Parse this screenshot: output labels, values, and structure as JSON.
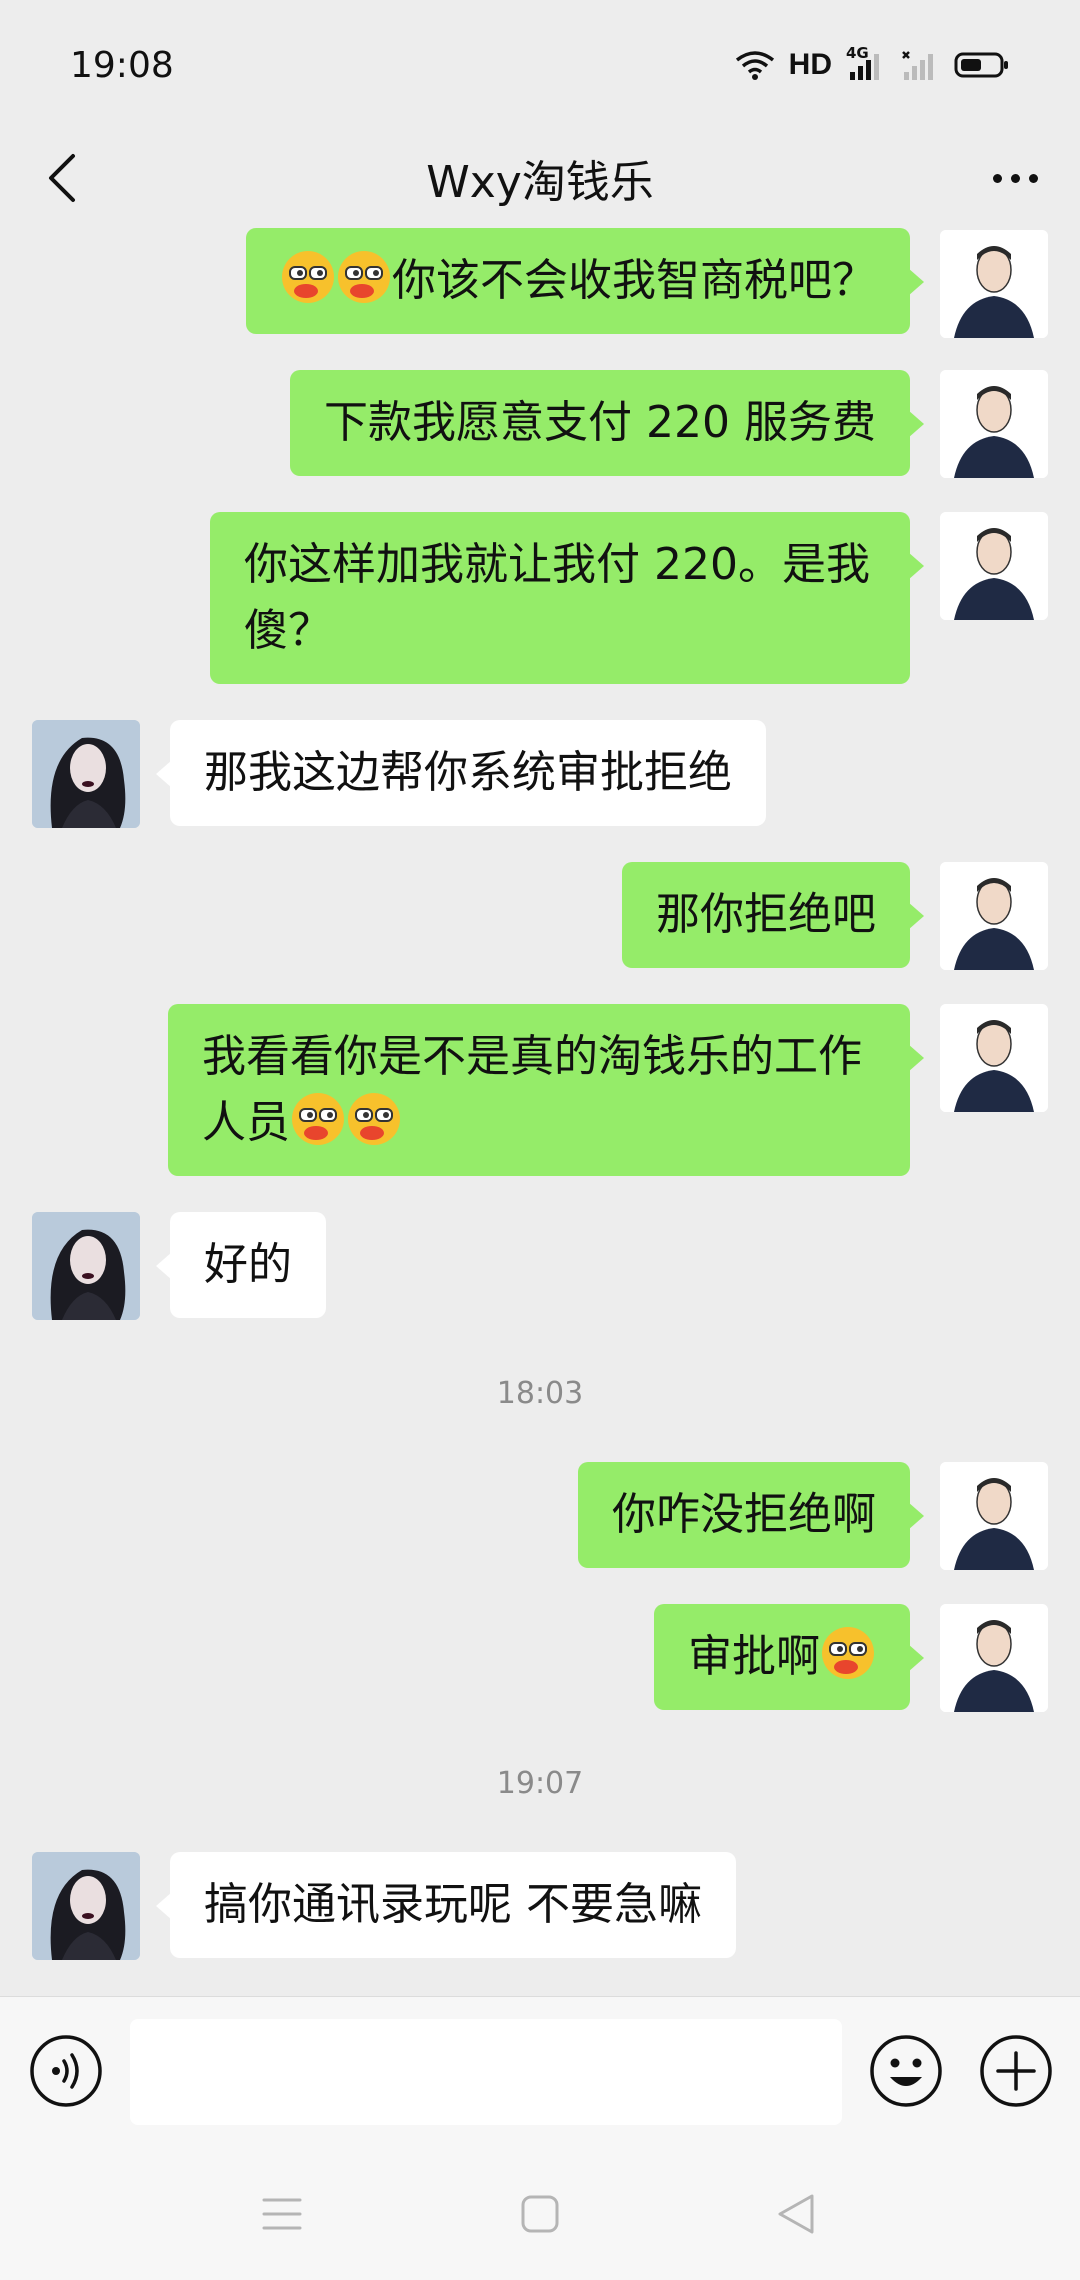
{
  "status_bar": {
    "time": "19:08",
    "hd_label": "HD",
    "network_label": "4G",
    "icons": [
      "wifi-icon",
      "hd-icon",
      "signal-4g-icon",
      "signal-icon",
      "battery-icon"
    ]
  },
  "header": {
    "title": "Wxy淘钱乐",
    "back_icon": "chevron-left-icon",
    "more_icon": "more-dots-icon"
  },
  "messages": [
    {
      "from": "me",
      "text": "你该不会收我智商税吧？",
      "emoji_prefix": 2
    },
    {
      "from": "me",
      "text": "下款我愿意支付 220 服务费"
    },
    {
      "from": "me",
      "line1": "你这样加我就让我付 220。是我",
      "line2": "傻？"
    },
    {
      "from": "them",
      "text": "那我这边帮你系统审批拒绝"
    },
    {
      "from": "me",
      "text": "那你拒绝吧"
    },
    {
      "from": "me",
      "line1": "我看看你是不是真的淘钱乐的工作",
      "line2": "人员",
      "emoji_suffix": 2
    },
    {
      "from": "them",
      "text": "好的"
    },
    {
      "type": "time",
      "text": "18:03"
    },
    {
      "from": "me",
      "text": "你咋没拒绝啊"
    },
    {
      "from": "me",
      "text": "审批啊",
      "emoji_suffix": 1
    },
    {
      "type": "time",
      "text": "19:07"
    },
    {
      "from": "them",
      "text": "搞你通讯录玩呢 不要急嘛"
    }
  ],
  "input_bar": {
    "voice_icon": "voice-icon",
    "emoji_icon": "emoji-face-icon",
    "plus_icon": "plus-icon",
    "input_value": ""
  },
  "nav_bar": {
    "icons": [
      "menu-icon",
      "home-square-icon",
      "back-triangle-icon"
    ]
  },
  "colors": {
    "background": "#ededed",
    "my_bubble": "#95ec69",
    "their_bubble": "#ffffff",
    "timestamp": "#8a8a8a"
  }
}
